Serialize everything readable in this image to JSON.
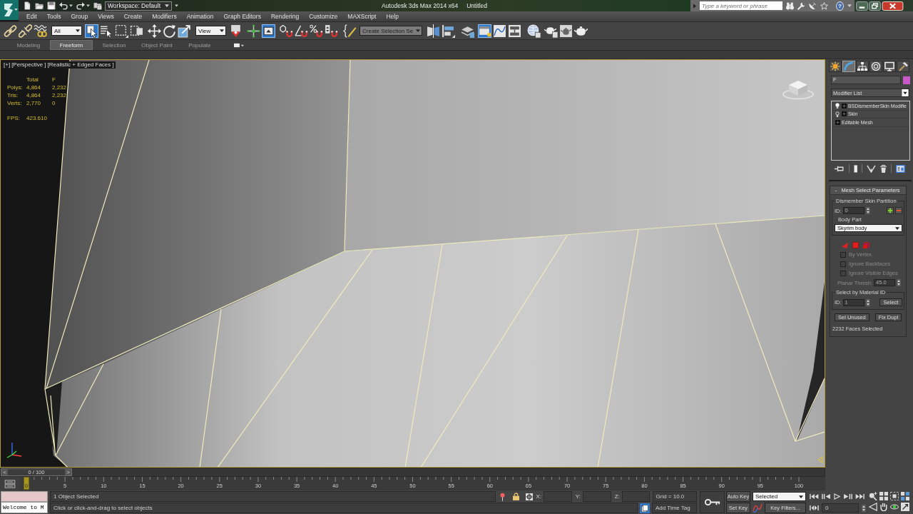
{
  "title_bar": {
    "workspace": "Workspace: Default",
    "app_title": "Autodesk 3ds Max 2014 x64",
    "document": "Untitled",
    "search": {
      "placeholder": "Type a keyword or phrase"
    },
    "help": "?"
  },
  "menu": [
    "Edit",
    "Tools",
    "Group",
    "Views",
    "Create",
    "Modifiers",
    "Animation",
    "Graph Editors",
    "Rendering",
    "Customize",
    "MAXScript",
    "Help"
  ],
  "main_toolbar": [
    {
      "kind": "link",
      "on": false
    },
    {
      "kind": "unlink",
      "on": false
    },
    {
      "kind": "bind",
      "on": false
    },
    {
      "kind": "dropdown",
      "value": "All"
    },
    {
      "kind": "select",
      "on": true
    },
    {
      "kind": "select-by-name",
      "on": false
    },
    {
      "kind": "region",
      "on": false
    },
    {
      "kind": "window",
      "on": false
    },
    {
      "kind": "move",
      "on": false
    },
    {
      "kind": "rotate",
      "on": false
    },
    {
      "kind": "scale",
      "on": false
    },
    {
      "kind": "dropdown",
      "value": "View"
    },
    {
      "kind": "pivot",
      "on": false
    },
    {
      "kind": "manipulate",
      "on": false
    },
    {
      "kind": "override",
      "on": true
    },
    {
      "kind": "snap",
      "on": false
    },
    {
      "kind": "angle-snap",
      "on": false
    },
    {
      "kind": "percent-snap",
      "on": false
    },
    {
      "kind": "spinner-snap",
      "on": false
    },
    {
      "kind": "named-sets",
      "on": false
    },
    {
      "kind": "combo",
      "value": "Create Selection Se"
    },
    {
      "kind": "mirror",
      "on": false
    },
    {
      "kind": "align",
      "on": false
    },
    {
      "kind": "layers",
      "on": false
    },
    {
      "kind": "ribbon-toggle",
      "on": true
    },
    {
      "kind": "curve-editor",
      "on": false
    },
    {
      "kind": "schematic",
      "on": false
    },
    {
      "kind": "material-editor",
      "on": false
    },
    {
      "kind": "render-setup",
      "on": false
    },
    {
      "kind": "frame-window",
      "on": false
    },
    {
      "kind": "render",
      "on": false
    }
  ],
  "ribbon_tabs": [
    {
      "label": "Modeling",
      "selected": false
    },
    {
      "label": "Freeform",
      "selected": true
    },
    {
      "label": "Selection",
      "selected": false
    },
    {
      "label": "Object Paint",
      "selected": false
    },
    {
      "label": "Populate",
      "selected": false
    }
  ],
  "viewport": {
    "active": true,
    "labels": [
      "[+]",
      "[Perspective ]",
      "[Realistic + Edged Faces ]"
    ],
    "stats": {
      "columns": [
        "Total",
        "F"
      ],
      "rows": [
        {
          "label": "Polys:",
          "values": [
            "4,864",
            "2,232"
          ]
        },
        {
          "label": "Tris:",
          "values": [
            "4,864",
            "2,232"
          ]
        },
        {
          "label": "Verts:",
          "values": [
            "2,770",
            "0"
          ]
        }
      ],
      "fps": {
        "label": "FPS:",
        "value": "423.610"
      }
    }
  },
  "command_panel": {
    "tabs": [
      {
        "kind": "create",
        "selected": false
      },
      {
        "kind": "modify",
        "selected": true
      },
      {
        "kind": "hierarchy",
        "selected": false
      },
      {
        "kind": "motion",
        "selected": false
      },
      {
        "kind": "display",
        "selected": false
      },
      {
        "kind": "utilities",
        "selected": false
      }
    ],
    "object_name": "F",
    "modifier_list": "Modifier List",
    "modifier_stack": [
      {
        "kind": "modifier",
        "label": "BSDismemberSkin Modifie",
        "on": true
      },
      {
        "kind": "modifier",
        "label": "Skin",
        "on": false
      },
      {
        "kind": "object",
        "label": "Editable Mesh"
      }
    ],
    "rollout": {
      "toggle": "-",
      "title": "Mesh Select Parameters",
      "partition": {
        "title": "Dismember Skin Partition",
        "id_label": "ID:",
        "id": "0",
        "body_part_label": "Body Part",
        "body_part": "Skyrim body"
      },
      "options": [
        {
          "label": "By Vertex",
          "checked": false,
          "disabled": true
        },
        {
          "label": "Ignore Backfaces",
          "checked": false,
          "disabled": true
        },
        {
          "label": "Ignore Visible Edges",
          "checked": false,
          "disabled": true
        }
      ],
      "planar_thresh": {
        "label": "Planar Thresh:",
        "value": "45.0",
        "disabled": true
      },
      "material": {
        "title": "Select by Material ID",
        "id_label": "ID:",
        "id": "1",
        "button": "Select"
      },
      "buttons": [
        "Sel Unused",
        "Fix Dupl"
      ],
      "summary": "2232 Faces Selected"
    }
  },
  "time_slider": {
    "prev": "<",
    "label": "0 / 100",
    "next": ">"
  },
  "track_bar": {
    "current_frame": "0",
    "labels": [
      "5",
      "10",
      "15",
      "20",
      "25",
      "30",
      "35",
      "40",
      "45",
      "50",
      "55",
      "60",
      "65",
      "70",
      "75",
      "80",
      "85",
      "90",
      "95",
      "100"
    ]
  },
  "status_bar": {
    "listener_output": "Welcome to M",
    "selection": "1 Object Selected",
    "prompt": "Click or click-and-drag to select objects",
    "coordinates": [
      {
        "label": "X:"
      },
      {
        "label": "Y:"
      },
      {
        "label": "Z:"
      }
    ],
    "grid": "Grid = 10.0",
    "time_tag": "Add Time Tag",
    "auto_key": {
      "label": "Auto Key",
      "on": false
    },
    "key_mode": "Selected",
    "set_key": "Set Key",
    "key_filters": "Key Filters...",
    "frame": "0"
  }
}
